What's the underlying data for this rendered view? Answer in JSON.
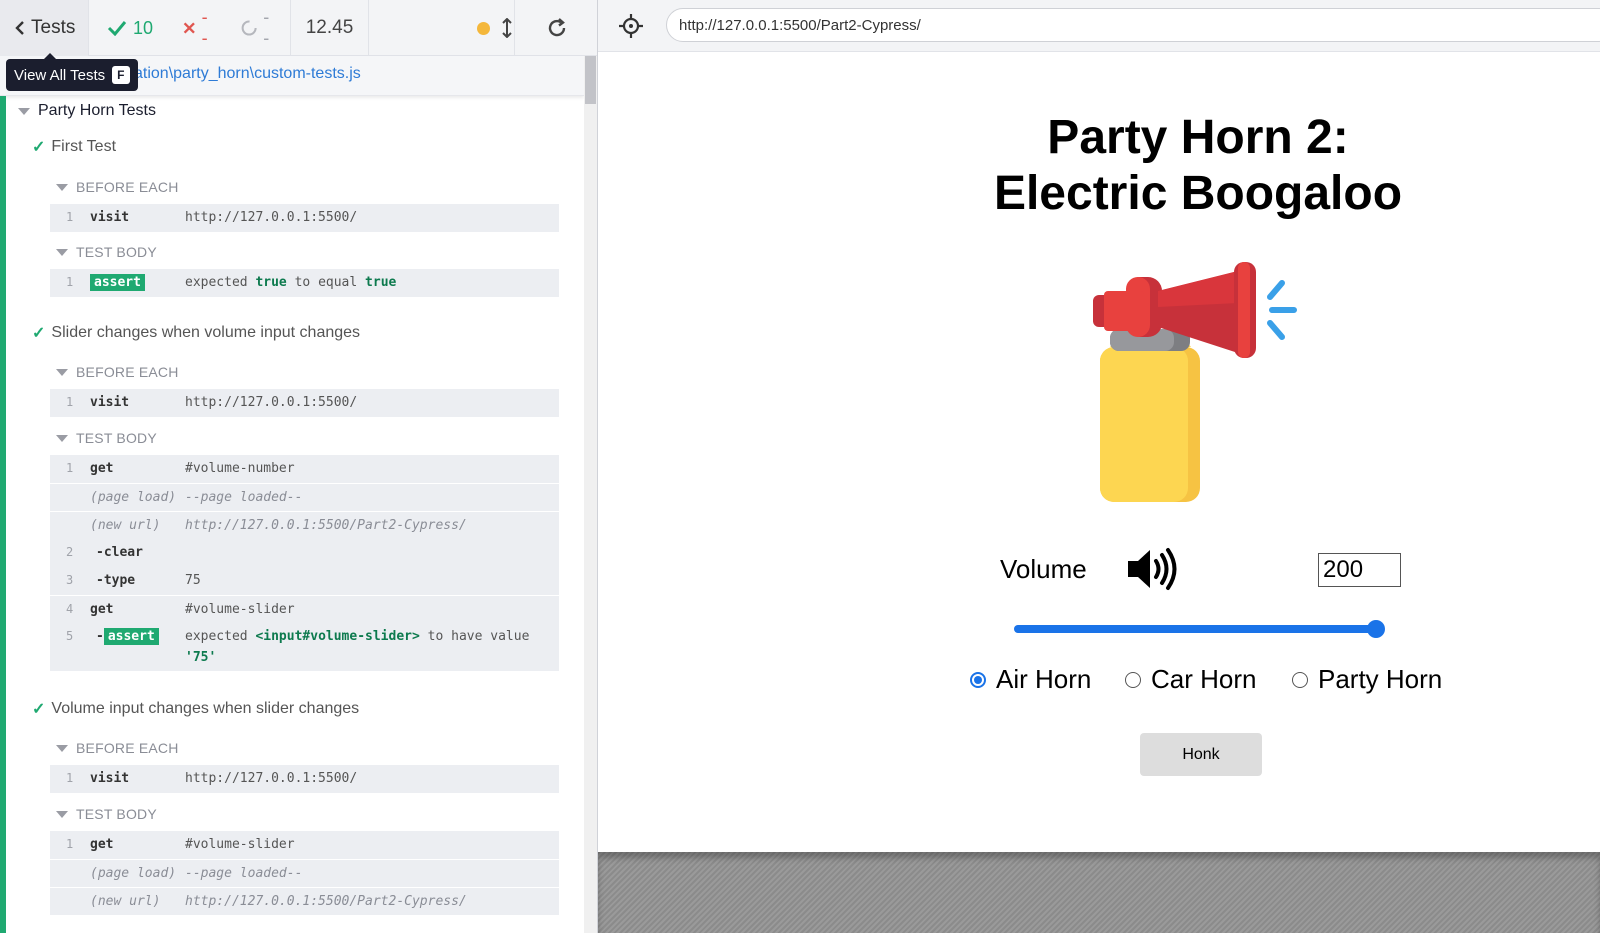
{
  "reporter": {
    "tests_label": "Tests",
    "tooltip": {
      "label": "View All Tests",
      "key": "F"
    },
    "stats": {
      "passed": "10",
      "failed": "--",
      "pending": "--"
    },
    "duration": "12.45",
    "spec_path": "ation\\party_horn\\custom-tests.js",
    "suite_title": "Party Horn Tests",
    "tests": [
      {
        "title": "First Test",
        "before_each_label": "BEFORE EACH",
        "before_each": [
          {
            "num": "1",
            "name": "visit",
            "msg": "http://127.0.0.1:5500/"
          }
        ],
        "test_body_label": "TEST BODY",
        "body": [
          {
            "num": "1",
            "badge": "assert",
            "pre": "expected ",
            "v1": "true",
            "mid": " to equal ",
            "v2": "true"
          }
        ]
      },
      {
        "title": "Slider changes when volume input changes",
        "before_each_label": "BEFORE EACH",
        "before_each": [
          {
            "num": "1",
            "name": "visit",
            "msg": "http://127.0.0.1:5500/"
          }
        ],
        "test_body_label": "TEST BODY",
        "body": [
          {
            "num": "1",
            "name": "get",
            "msg": "#volume-number"
          },
          {
            "num": "",
            "name": "(page load)",
            "msg": "--page loaded--"
          },
          {
            "num": "",
            "name": "(new url)",
            "msg": "http://127.0.0.1:5500/Part2-Cypress/"
          },
          {
            "num": "2",
            "name": "-clear",
            "msg": ""
          },
          {
            "num": "3",
            "name": "-type",
            "msg": "75"
          },
          {
            "num": "4",
            "name": "get",
            "msg": "#volume-slider"
          },
          {
            "num": "5",
            "badge": "assert",
            "pre": "expected ",
            "v1": "<input#volume-slider>",
            "mid": " to have value",
            "v2": "'75'"
          }
        ]
      },
      {
        "title": "Volume input changes when slider changes",
        "before_each_label": "BEFORE EACH",
        "before_each": [
          {
            "num": "1",
            "name": "visit",
            "msg": "http://127.0.0.1:5500/"
          }
        ],
        "test_body_label": "TEST BODY",
        "body": [
          {
            "num": "1",
            "name": "get",
            "msg": "#volume-slider"
          },
          {
            "num": "",
            "name": "(page load)",
            "msg": "--page loaded--"
          },
          {
            "num": "",
            "name": "(new url)",
            "msg": "http://127.0.0.1:5500/Part2-Cypress/"
          }
        ]
      }
    ]
  },
  "aut": {
    "url": "http://127.0.0.1:5500/Part2-Cypress/",
    "title_line1": "Party Horn 2:",
    "title_line2": "Electric Boogaloo",
    "volume_label": "Volume",
    "volume_value": "200",
    "slider_fraction": 1.0,
    "radios": [
      {
        "label": "Air Horn",
        "checked": true
      },
      {
        "label": "Car Horn",
        "checked": false
      },
      {
        "label": "Party Horn",
        "checked": false
      }
    ],
    "honk_label": "Honk"
  },
  "colors": {
    "pass": "#1fa971",
    "fail": "#e05650",
    "accent": "#1a73e8",
    "link": "#2e7bd6"
  }
}
